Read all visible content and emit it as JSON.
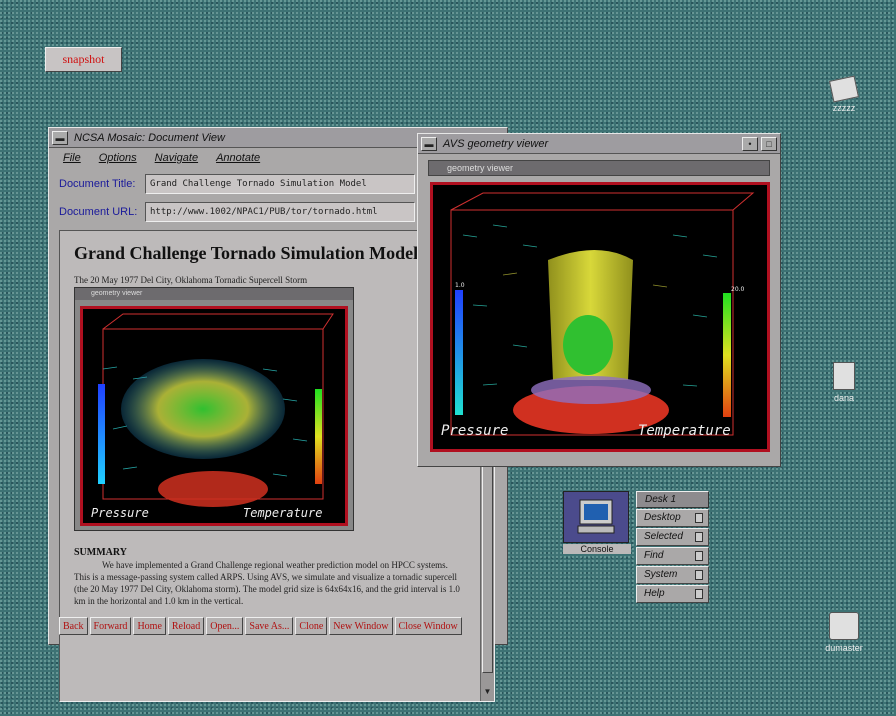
{
  "snapshot_button": "snapshot",
  "desktop_icons": [
    {
      "label": "zzzzz"
    },
    {
      "label": "dana"
    },
    {
      "label": "dumaster"
    }
  ],
  "mosaic": {
    "title": "NCSA Mosaic: Document View",
    "menu": [
      "File",
      "Options",
      "Navigate",
      "Annotate"
    ],
    "doc_title_label": "Document Title:",
    "doc_title_value": "Grand Challenge Tornado Simulation Model",
    "doc_url_label": "Document URL:",
    "doc_url_value": "http://www.1002/NPAC1/PUB/tor/tornado.html",
    "page_heading": "Grand Challenge Tornado Simulation Model",
    "page_subheading": "The 20 May 1977 Del City, Oklahoma Tornadic Supercell Storm",
    "embedded_viewer_title": "geometry viewer",
    "embedded_left_label": "Pressure",
    "embedded_right_label": "Temperature",
    "summary_heading": "SUMMARY",
    "summary_text": "We have implemented a Grand Challenge regional weather prediction model on HPCC systems. This is a message-passing system called ARPS. Using AVS, we simulate and visualize a tornadic supercell (the 20 May 1977 Del City, Oklahoma storm). The model grid size is 64x64x16, and the grid interval is 1.0 km in the horizontal and 1.0 km in the vertical.",
    "buttons": [
      "Back",
      "Forward",
      "Home",
      "Reload",
      "Open...",
      "Save As...",
      "Clone",
      "New Window",
      "Close Window"
    ]
  },
  "avs": {
    "title": "AVS geometry viewer",
    "viewer_title": "geometry viewer",
    "left_label": "Pressure",
    "right_label": "Temperature",
    "left_scale": "1.0",
    "right_scale": "20.0"
  },
  "console": {
    "label": "Console"
  },
  "desk_menu": {
    "title": "Desk 1",
    "items": [
      "Desktop",
      "Selected",
      "Find",
      "System",
      "Help"
    ]
  },
  "colors": {
    "link_blue": "#1a1a9a",
    "button_red": "#b01010",
    "viewer_border": "#b01020"
  }
}
